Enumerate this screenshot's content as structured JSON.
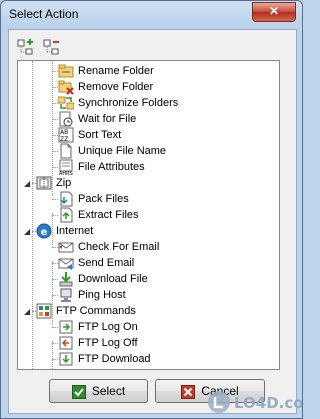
{
  "window": {
    "title": "Select Action",
    "close_glyph": "✕"
  },
  "toolbar": {
    "expand_icon": "expand-all-icon",
    "collapse_icon": "collapse-all-icon"
  },
  "tree": {
    "items": [
      {
        "label": "Rename Folder",
        "icon": "rename-folder-icon",
        "level": 2
      },
      {
        "label": "Remove Folder",
        "icon": "remove-folder-icon",
        "level": 2
      },
      {
        "label": "Synchronize Folders",
        "icon": "synchronize-folders-icon",
        "level": 2
      },
      {
        "label": "Wait for File",
        "icon": "wait-for-file-icon",
        "level": 2
      },
      {
        "label": "Sort Text",
        "icon": "sort-text-icon",
        "level": 2
      },
      {
        "label": "Unique File Name",
        "icon": "unique-file-name-icon",
        "level": 2
      },
      {
        "label": "File Attributes",
        "icon": "file-attributes-icon",
        "level": 2
      },
      {
        "label": "Zip",
        "icon": "zip-icon",
        "level": 1
      },
      {
        "label": "Pack Files",
        "icon": "pack-files-icon",
        "level": 2
      },
      {
        "label": "Extract Files",
        "icon": "extract-files-icon",
        "level": 2
      },
      {
        "label": "Internet",
        "icon": "internet-icon",
        "level": 1
      },
      {
        "label": "Check For Email",
        "icon": "check-email-icon",
        "level": 2
      },
      {
        "label": "Send Email",
        "icon": "send-email-icon",
        "level": 2
      },
      {
        "label": "Download File",
        "icon": "download-file-icon",
        "level": 2
      },
      {
        "label": "Ping Host",
        "icon": "ping-host-icon",
        "level": 2
      },
      {
        "label": "FTP Commands",
        "icon": "ftp-commands-icon",
        "level": 1
      },
      {
        "label": "FTP Log On",
        "icon": "ftp-log-on-icon",
        "level": 2
      },
      {
        "label": "FTP Log Off",
        "icon": "ftp-log-off-icon",
        "level": 2
      },
      {
        "label": "FTP Download",
        "icon": "ftp-download-icon",
        "level": 2
      }
    ]
  },
  "buttons": {
    "select_label": "Select",
    "cancel_label": "Cancel"
  },
  "colors": {
    "title_bar": "#b9d1ea",
    "close_button": "#c8483a",
    "tree_background": "#ffffff",
    "dialog_background": "#f0f0f0"
  }
}
